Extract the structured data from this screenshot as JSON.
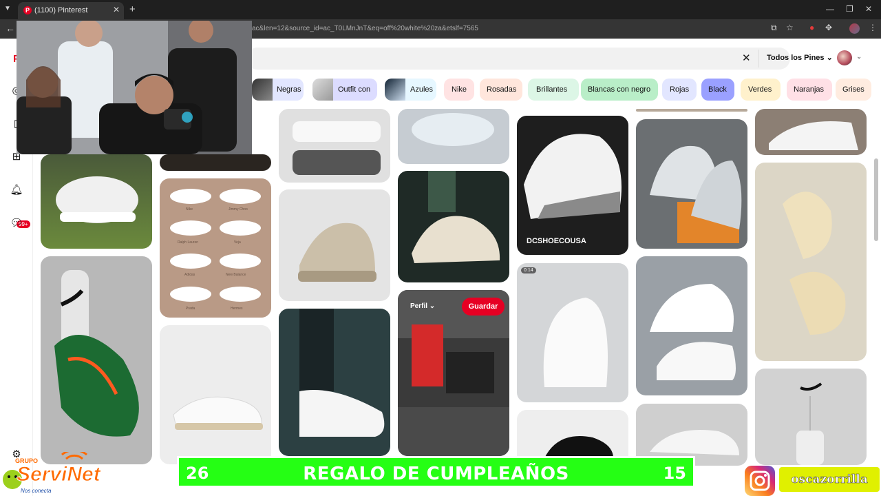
{
  "browser": {
    "tab_title": "(1100) Pinterest",
    "url_fragment": "ac&len=12&source_id=ac_T0LMnJnT&eq=off%20white%20za&etslf=7565",
    "new_tab": "+",
    "back": "←"
  },
  "pinterest": {
    "filter_dropdown": "Todos los Pines",
    "notifications_badge": "99+",
    "clear_search": "✕",
    "chips": [
      {
        "label": "Negras",
        "bg": "#e2e6ff"
      },
      {
        "label": "Outfit con",
        "bg": "#dcdcff"
      },
      {
        "label": "Azules",
        "bg": "#e6f7ff"
      },
      {
        "label": "Nike",
        "bg": "#ffe3e3"
      },
      {
        "label": "Rosadas",
        "bg": "#ffe6dc"
      },
      {
        "label": "Brillantes",
        "bg": "#dcf6e6"
      },
      {
        "label": "Blancas con negro",
        "bg": "#b9eec8"
      },
      {
        "label": "Rojas",
        "bg": "#e2e6ff"
      },
      {
        "label": "Black",
        "bg": "#9aa0ff"
      },
      {
        "label": "Verdes",
        "bg": "#fff1cc"
      },
      {
        "label": "Naranjas",
        "bg": "#ffe0e6"
      },
      {
        "label": "Grises",
        "bg": "#ffece0"
      }
    ],
    "hover_pin": {
      "profile_label": "Perfil",
      "save_label": "Guardar",
      "video_duration": "0:14"
    },
    "pin_texts": {
      "dc_brand": "DCSHOECOUSA",
      "shoe_names": [
        "Nike",
        "Jimmy Choo",
        "Ralph Lauren",
        "Veja",
        "Adidas",
        "New Balance",
        "Prada",
        "Hermes"
      ]
    }
  },
  "overlay": {
    "banner_left": "26",
    "banner_title": "REGALO DE CUMPLEAÑOS",
    "banner_right": "15",
    "instagram_handle": "oscazorrilla",
    "sponsor_top": "GRUPO",
    "sponsor_name": "ServiNet",
    "sponsor_tagline": "Nos conecta"
  },
  "colors": {
    "pinterest_red": "#e60023",
    "banner_green": "#25ff14",
    "handle_yellow": "#e0f000"
  }
}
